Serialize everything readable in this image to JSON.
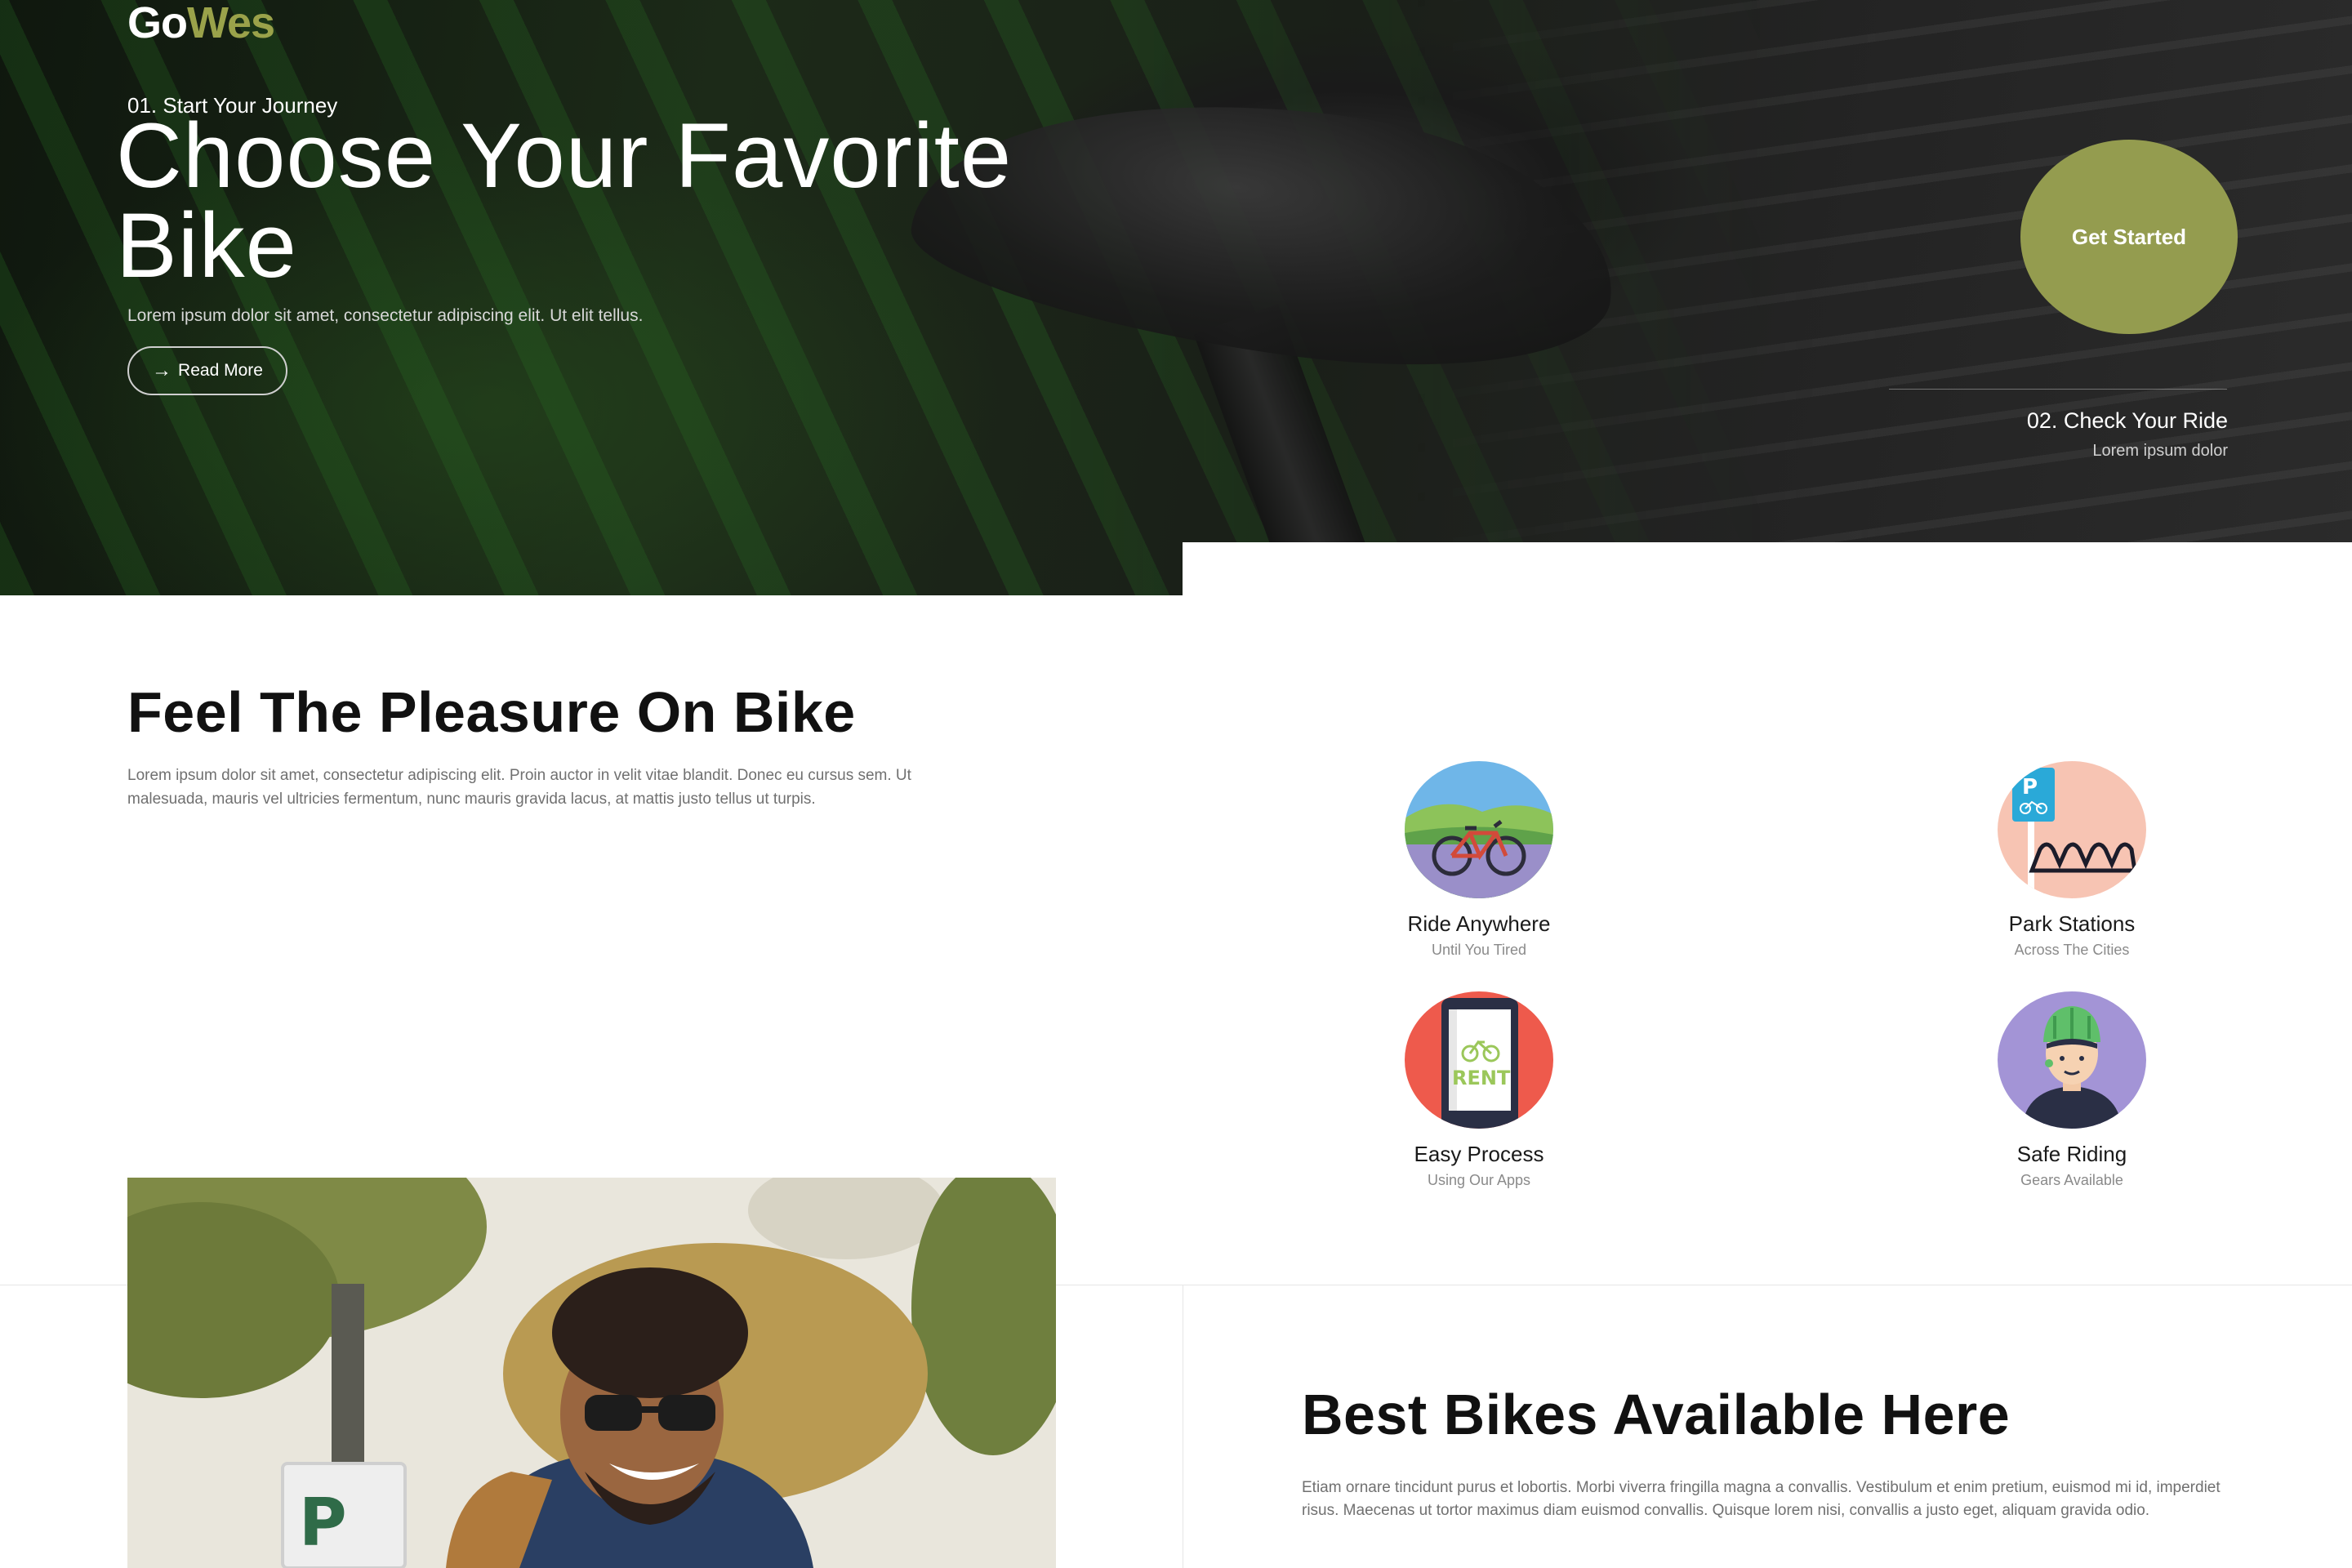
{
  "brand": {
    "logo_go": "Go",
    "logo_wes": "Wes",
    "accent": "#949c4f"
  },
  "hero": {
    "step_label": "01. Start Your Journey",
    "title": "Choose Your Favorite Bike",
    "description": "Lorem ipsum dolor sit amet, consectetur adipiscing elit. Ut elit tellus.",
    "read_more_label": "Read More",
    "read_more_icon": "arrow-right-icon",
    "cta_label": "Get Started",
    "check_title": "02. Check Your Ride",
    "check_subtitle": "Lorem ipsum dolor"
  },
  "pleasure": {
    "title": "Feel The Pleasure On Bike",
    "description": "Lorem ipsum dolor sit amet, consectetur adipiscing elit. Proin auctor in velit vitae blandit. Donec eu cursus sem. Ut malesuada, mauris vel ultricies fermentum, nunc mauris gravida lacus, at mattis justo tellus ut turpis."
  },
  "features": [
    {
      "title": "Ride Anywhere",
      "subtitle": "Until You Tired",
      "icon": "bicycle-landscape-icon"
    },
    {
      "title": "Park Stations",
      "subtitle": "Across The Cities",
      "icon": "parking-sign-icon"
    },
    {
      "title": "Easy Process",
      "subtitle": "Using Our Apps",
      "icon": "phone-rent-icon",
      "icon_text": "RENT"
    },
    {
      "title": "Safe Riding",
      "subtitle": "Gears Available",
      "icon": "helmet-rider-icon"
    }
  ],
  "best_bikes": {
    "title": "Best Bikes Available Here",
    "description": "Etiam ornare tincidunt purus et lobortis. Morbi viverra fringilla magna a convallis. Vestibulum et enim pretium, euismod mi id, imperdiet risus. Maecenas ut tortor maximus diam euismod convallis. Quisque lorem nisi, convallis a justo eget, aliquam gravida odio.",
    "photo_sign_text": "P"
  }
}
